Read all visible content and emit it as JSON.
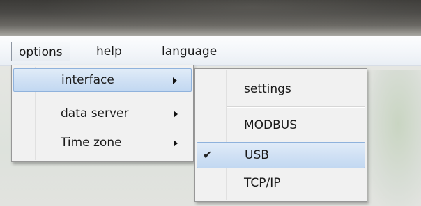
{
  "menubar": {
    "items": [
      {
        "label": "options"
      },
      {
        "label": "help"
      },
      {
        "label": "language"
      }
    ]
  },
  "options_menu": {
    "items": [
      {
        "label": "interface",
        "submenu": true,
        "highlighted": true
      },
      {
        "label": "data server",
        "submenu": true
      },
      {
        "label": "Time zone",
        "submenu": true
      }
    ]
  },
  "interface_menu": {
    "items": [
      {
        "label": "settings"
      },
      {
        "label": "MODBUS"
      },
      {
        "label": "USB",
        "checked": true,
        "highlighted": true,
        "check_glyph": "✔"
      },
      {
        "label": "TCP/IP"
      }
    ]
  },
  "colors": {
    "highlight": "#cfe0f4",
    "highlight_border": "#8fb2dc",
    "menu_bg": "#f1f1f1"
  }
}
